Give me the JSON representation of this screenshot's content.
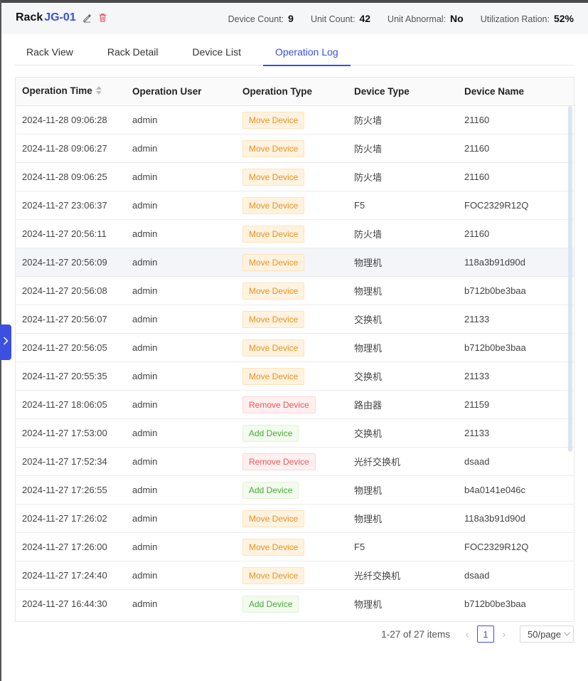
{
  "header": {
    "rack_label": "Rack",
    "rack_id": "JG-01",
    "stats": [
      {
        "label": "Device Count:",
        "value": "9"
      },
      {
        "label": "Unit Count:",
        "value": "42"
      },
      {
        "label": "Unit Abnormal:",
        "value": "No"
      },
      {
        "label": "Utilization Ration:",
        "value": "52%"
      }
    ]
  },
  "tabs": [
    {
      "label": "Rack View"
    },
    {
      "label": "Rack Detail"
    },
    {
      "label": "Device List"
    },
    {
      "label": "Operation Log"
    }
  ],
  "active_tab": "Operation Log",
  "table": {
    "columns": [
      "Operation Time",
      "Operation User",
      "Operation Type",
      "Device Type",
      "Device Name"
    ],
    "rows": [
      {
        "time": "2024-11-28 09:06:28",
        "user": "admin",
        "op": "Move Device",
        "kind": "move",
        "dtype": "防火墙",
        "dname": "21160"
      },
      {
        "time": "2024-11-28 09:06:27",
        "user": "admin",
        "op": "Move Device",
        "kind": "move",
        "dtype": "防火墙",
        "dname": "21160"
      },
      {
        "time": "2024-11-28 09:06:25",
        "user": "admin",
        "op": "Move Device",
        "kind": "move",
        "dtype": "防火墙",
        "dname": "21160"
      },
      {
        "time": "2024-11-27 23:06:37",
        "user": "admin",
        "op": "Move Device",
        "kind": "move",
        "dtype": "F5",
        "dname": "FOC2329R12Q"
      },
      {
        "time": "2024-11-27 20:56:11",
        "user": "admin",
        "op": "Move Device",
        "kind": "move",
        "dtype": "防火墙",
        "dname": "21160"
      },
      {
        "time": "2024-11-27 20:56:09",
        "user": "admin",
        "op": "Move Device",
        "kind": "move",
        "dtype": "物理机",
        "dname": "118a3b91d90d"
      },
      {
        "time": "2024-11-27 20:56:08",
        "user": "admin",
        "op": "Move Device",
        "kind": "move",
        "dtype": "物理机",
        "dname": "b712b0be3baa"
      },
      {
        "time": "2024-11-27 20:56:07",
        "user": "admin",
        "op": "Move Device",
        "kind": "move",
        "dtype": "交换机",
        "dname": "21133"
      },
      {
        "time": "2024-11-27 20:56:05",
        "user": "admin",
        "op": "Move Device",
        "kind": "move",
        "dtype": "物理机",
        "dname": "b712b0be3baa"
      },
      {
        "time": "2024-11-27 20:55:35",
        "user": "admin",
        "op": "Move Device",
        "kind": "move",
        "dtype": "交换机",
        "dname": "21133"
      },
      {
        "time": "2024-11-27 18:06:05",
        "user": "admin",
        "op": "Remove Device",
        "kind": "remove",
        "dtype": "路由器",
        "dname": "21159"
      },
      {
        "time": "2024-11-27 17:53:00",
        "user": "admin",
        "op": "Add Device",
        "kind": "add",
        "dtype": "交换机",
        "dname": "21133"
      },
      {
        "time": "2024-11-27 17:52:34",
        "user": "admin",
        "op": "Remove Device",
        "kind": "remove",
        "dtype": "光纤交换机",
        "dname": "dsaad"
      },
      {
        "time": "2024-11-27 17:26:55",
        "user": "admin",
        "op": "Add Device",
        "kind": "add",
        "dtype": "物理机",
        "dname": "b4a0141e046c"
      },
      {
        "time": "2024-11-27 17:26:02",
        "user": "admin",
        "op": "Move Device",
        "kind": "move",
        "dtype": "物理机",
        "dname": "118a3b91d90d"
      },
      {
        "time": "2024-11-27 17:26:00",
        "user": "admin",
        "op": "Move Device",
        "kind": "move",
        "dtype": "F5",
        "dname": "FOC2329R12Q"
      },
      {
        "time": "2024-11-27 17:24:40",
        "user": "admin",
        "op": "Move Device",
        "kind": "move",
        "dtype": "光纤交换机",
        "dname": "dsaad"
      },
      {
        "time": "2024-11-27 16:44:30",
        "user": "admin",
        "op": "Add Device",
        "kind": "add",
        "dtype": "物理机",
        "dname": "b712b0be3baa"
      }
    ]
  },
  "pagination": {
    "total_text": "1-27 of 27 items",
    "current_page": "1",
    "page_size": "50/page"
  },
  "colors": {
    "accent": "#3b4fe0",
    "move": "#e8901e",
    "remove": "#e4575d",
    "add": "#4aa93a"
  }
}
